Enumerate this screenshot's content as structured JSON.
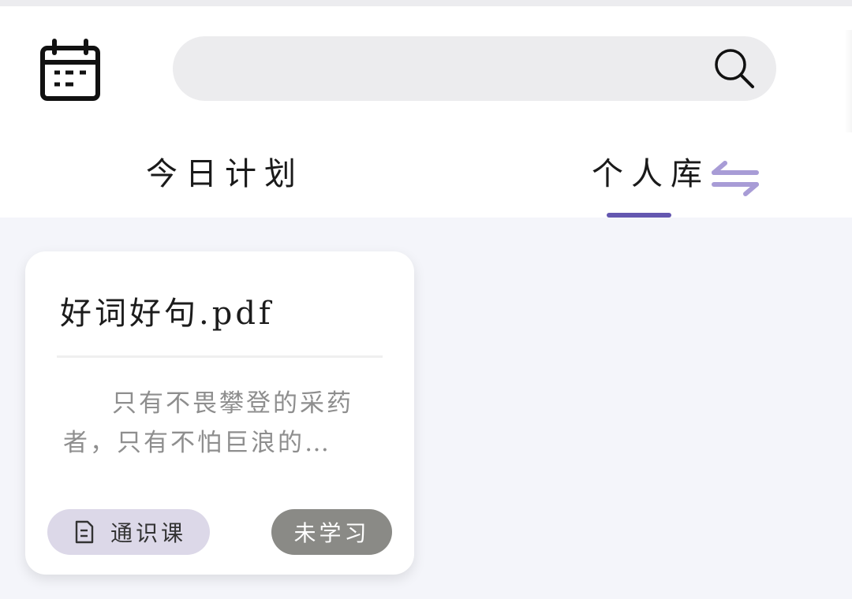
{
  "header": {
    "search": {
      "placeholder": "",
      "value": ""
    }
  },
  "tabs": [
    {
      "label": "今日计划",
      "active": false
    },
    {
      "label": "个人库",
      "active": true
    }
  ],
  "colors": {
    "accent": "#6457b0",
    "swap_icon": "#a89cd6",
    "tag_bg": "#dcd8e8",
    "status_bg": "#8a8a86"
  },
  "icons": {
    "calendar": "calendar-icon",
    "search": "search-icon",
    "swap": "swap-arrows-icon",
    "document": "document-icon"
  },
  "cards": [
    {
      "title": "好词好句.pdf",
      "excerpt": "只有不畏攀登的采药者，只有不怕巨浪的…",
      "course_tag": "通识课",
      "status": "未学习"
    }
  ]
}
